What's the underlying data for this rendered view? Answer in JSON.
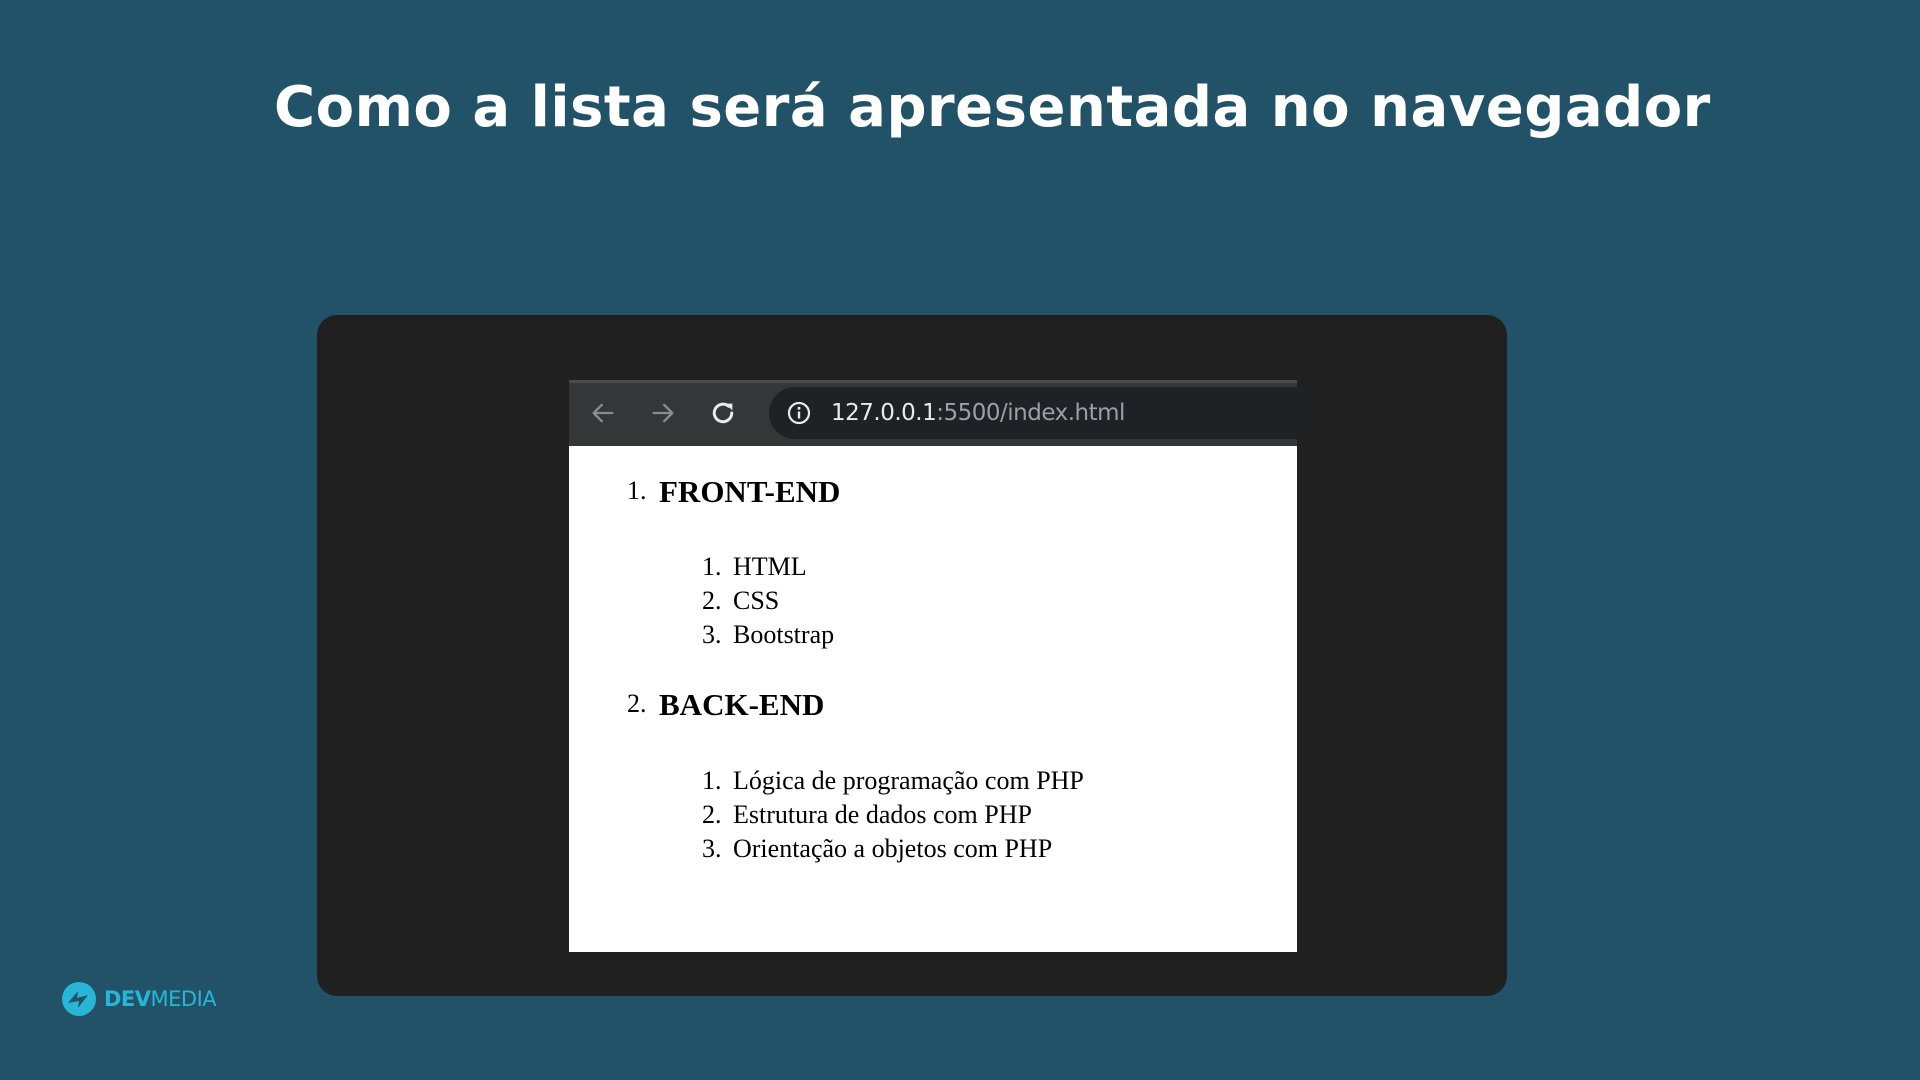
{
  "slide": {
    "title": "Como a lista será apresentada no navegador"
  },
  "browser": {
    "url_host": "127.0.0.1",
    "url_path": ":5500/index.html",
    "icons": {
      "back": "arrow-left-icon",
      "forward": "arrow-right-icon",
      "reload": "reload-icon",
      "site_info": "info-icon"
    }
  },
  "page": {
    "sections": [
      {
        "number": "1.",
        "heading": "FRONT-END",
        "items": [
          {
            "number": "1.",
            "text": "HTML"
          },
          {
            "number": "2.",
            "text": "CSS"
          },
          {
            "number": "3.",
            "text": "Bootstrap"
          }
        ]
      },
      {
        "number": "2.",
        "heading": "BACK-END",
        "items": [
          {
            "number": "1.",
            "text": "Lógica de programação com PHP"
          },
          {
            "number": "2.",
            "text": "Estrutura de dados com PHP"
          },
          {
            "number": "3.",
            "text": "Orientação a objetos com PHP"
          }
        ]
      }
    ]
  },
  "logo": {
    "text_bold": "DEV",
    "text_light": "MEDIA",
    "color": "#29b6d6"
  },
  "colors": {
    "background": "#215268",
    "frame": "#202020",
    "toolbar": "#353638",
    "omnibox": "#202124"
  }
}
